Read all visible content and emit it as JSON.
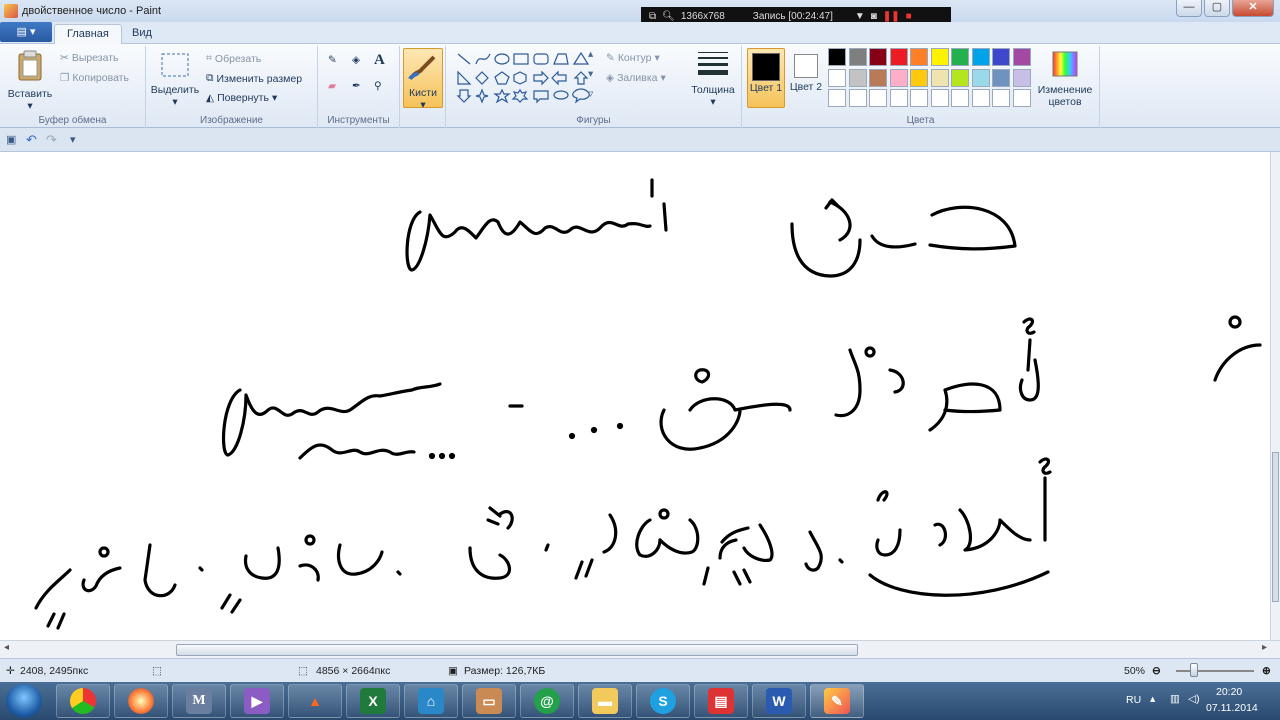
{
  "window": {
    "title": "двойственное число - Paint",
    "btn_min": "—",
    "btn_max": "▢",
    "btn_close": "✕"
  },
  "recorder": {
    "resolution": "1366x768",
    "record": "Запись [00:24:47]"
  },
  "tabs": {
    "file": "▤ ▾",
    "home": "Главная",
    "view": "Вид"
  },
  "clipboard": {
    "paste": "Вставить",
    "cut": "Вырезать",
    "copy": "Копировать",
    "label": "Буфер обмена"
  },
  "image": {
    "select": "Выделить",
    "crop": "Обрезать",
    "resize": "Изменить размер",
    "rotate": "Повернуть",
    "label": "Изображение"
  },
  "tools": {
    "label": "Инструменты"
  },
  "brushes": {
    "label": "Кисти"
  },
  "shapes": {
    "outline": "Контур",
    "fill": "Заливка",
    "label": "Фигуры"
  },
  "size": {
    "label": "Толщина"
  },
  "colors": {
    "color1": "Цвет 1",
    "color2": "Цвет 2",
    "edit": "Изменение цветов",
    "label": "Цвета",
    "palette": [
      "#000000",
      "#7f7f7f",
      "#880015",
      "#ed1c24",
      "#ff7f27",
      "#fff200",
      "#22b14c",
      "#00a2e8",
      "#3f48cc",
      "#a349a4",
      "#ffffff",
      "#c3c3c3",
      "#b97a57",
      "#ffaec9",
      "#ffc90e",
      "#efe4b0",
      "#b5e61d",
      "#99d9ea",
      "#7092be",
      "#c8bfe7"
    ]
  },
  "statusbar": {
    "cursor": "2408, 2495пкс",
    "dimensions": "4856 × 2664пкс",
    "filesize": "Размер: 126,7КБ",
    "zoom": "50%"
  },
  "taskbar": {
    "lang": "RU",
    "time": "20:20",
    "date": "07.11.2014"
  }
}
